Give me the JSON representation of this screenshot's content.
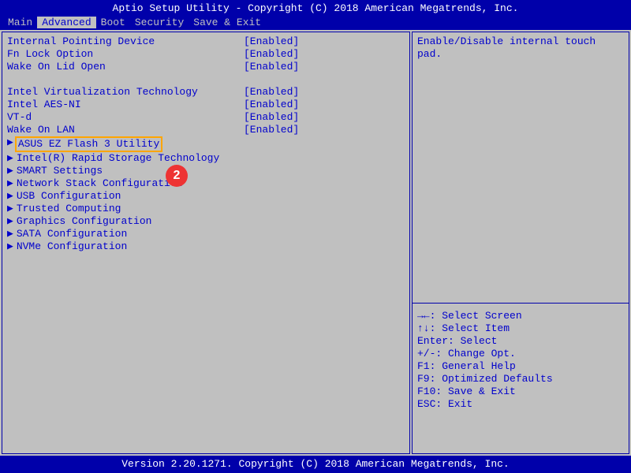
{
  "title": "Aptio Setup Utility - Copyright (C) 2018 American Megatrends, Inc.",
  "footer": "Version 2.20.1271. Copyright (C) 2018 American Megatrends, Inc.",
  "menu": {
    "items": [
      "Main",
      "Advanced",
      "Boot",
      "Security",
      "Save & Exit"
    ],
    "active": "Advanced"
  },
  "settings": {
    "group1": [
      {
        "label": "Internal Pointing Device",
        "value": "[Enabled]"
      },
      {
        "label": "Fn Lock Option",
        "value": "[Enabled]"
      },
      {
        "label": "Wake On Lid Open",
        "value": "[Enabled]"
      }
    ],
    "group2": [
      {
        "label": "Intel Virtualization Technology",
        "value": "[Enabled]"
      },
      {
        "label": "Intel AES-NI",
        "value": "[Enabled]"
      },
      {
        "label": "VT-d",
        "value": "[Enabled]"
      },
      {
        "label": "Wake On LAN",
        "value": "[Enabled]"
      }
    ]
  },
  "submenus": [
    "ASUS EZ Flash 3 Utility",
    "Intel(R) Rapid Storage Technology",
    "SMART Settings",
    "Network Stack Configuration",
    "USB Configuration",
    "Trusted Computing",
    "Graphics Configuration",
    "SATA Configuration",
    "NVMe Configuration"
  ],
  "help": {
    "description": "Enable/Disable internal touch pad.",
    "nav": [
      "→←: Select Screen",
      "↑↓: Select Item",
      "Enter: Select",
      "+/-: Change Opt.",
      "F1: General Help",
      "F9: Optimized Defaults",
      "F10: Save & Exit",
      "ESC: Exit"
    ]
  },
  "badge": {
    "number": "2"
  }
}
